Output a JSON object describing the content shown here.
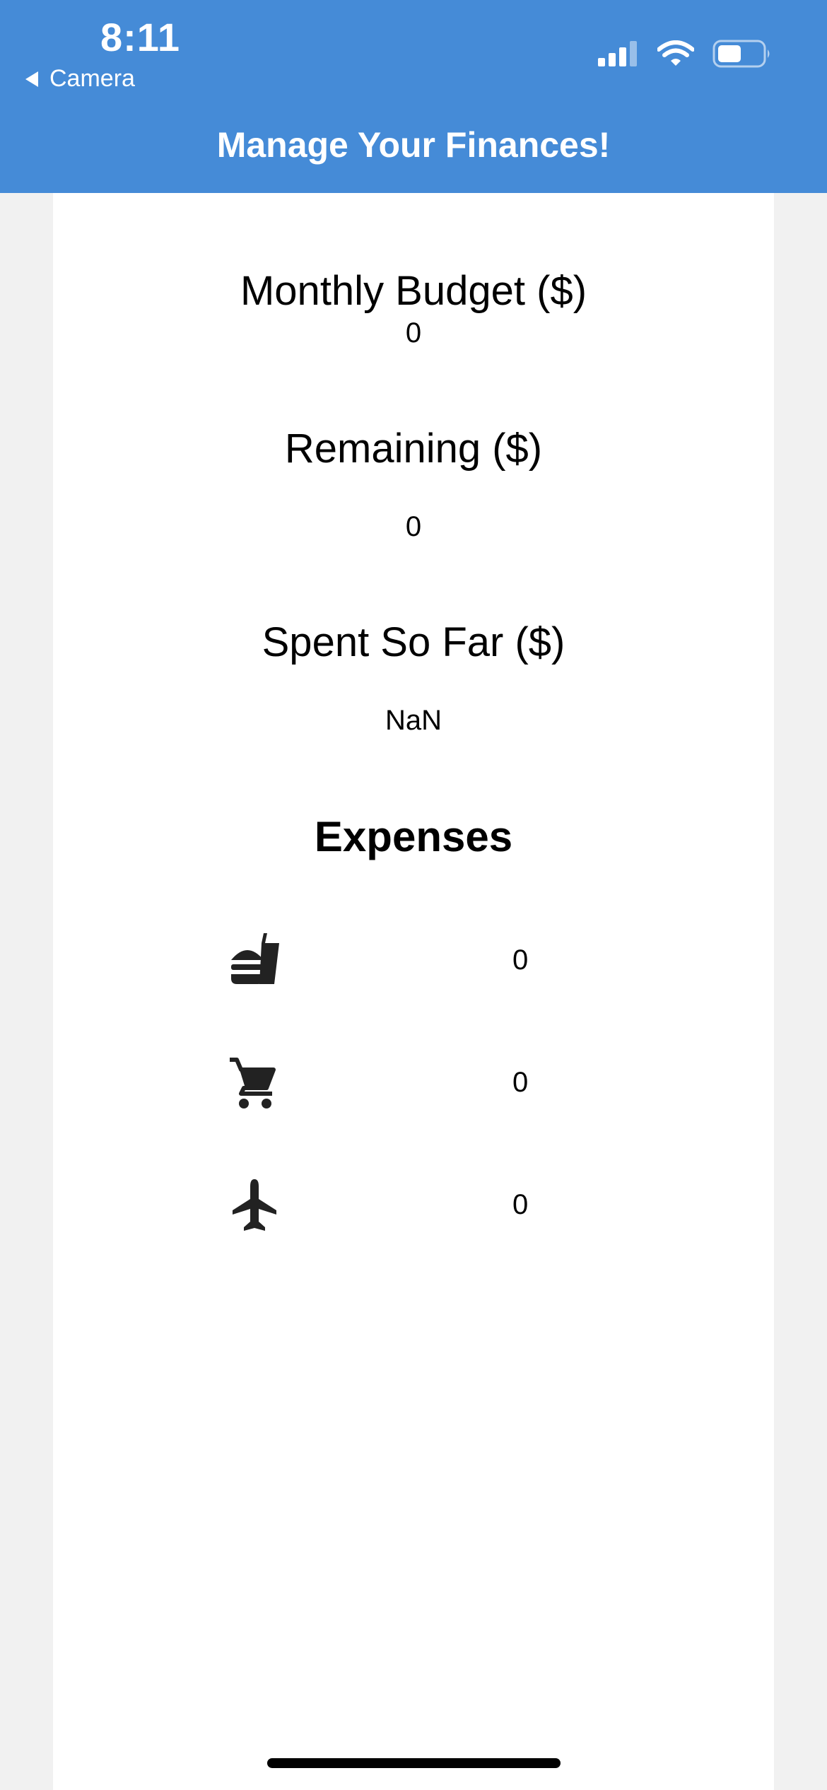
{
  "status_bar": {
    "time": "8:11",
    "back_label": "Camera",
    "icons": [
      "signal-icon",
      "wifi-icon",
      "battery-icon"
    ]
  },
  "header": {
    "title": "Manage Your Finances!",
    "color": "#458bd7"
  },
  "budget": {
    "monthly_label": "Monthly Budget ($)",
    "monthly_value": "0",
    "remaining_label": "Remaining ($)",
    "remaining_value": "0",
    "spent_label": "Spent So Far ($)",
    "spent_value": "NaN"
  },
  "expenses": {
    "title": "Expenses",
    "items": [
      {
        "icon": "fastfood-icon",
        "value": "0"
      },
      {
        "icon": "shopping-cart-icon",
        "value": "0"
      },
      {
        "icon": "airplane-icon",
        "value": "0"
      }
    ]
  }
}
